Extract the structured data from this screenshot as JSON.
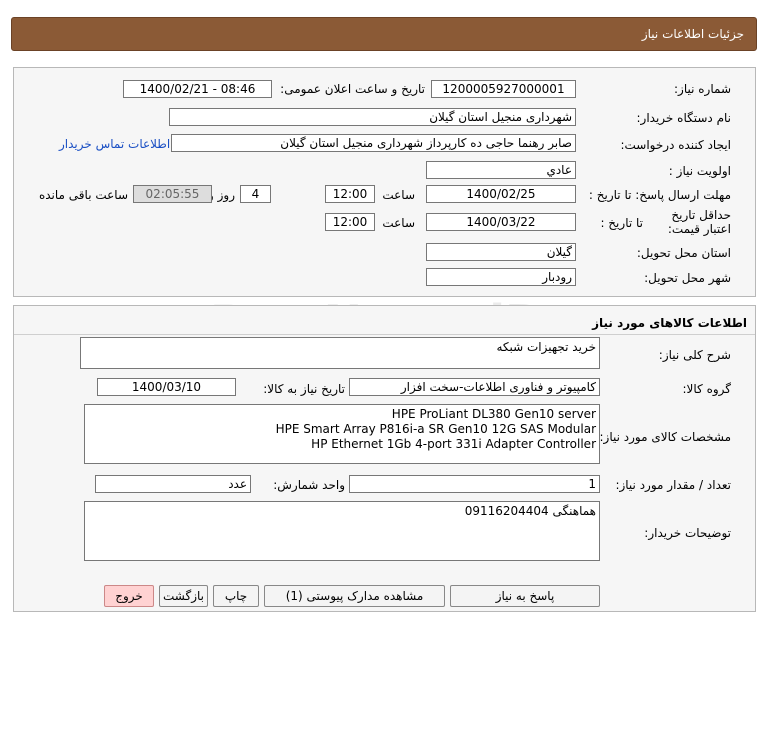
{
  "header": {
    "title": "جزئیات اطلاعات نیاز"
  },
  "need": {
    "number_label": "شماره نیاز:",
    "number": "1200005927000001",
    "announce_label": "تاریخ و ساعت اعلان عمومی:",
    "announce": "1400/02/21 - 08:46",
    "buyer_label": "نام دستگاه خریدار:",
    "buyer": "شهرداری منجیل استان گیلان",
    "requester_label": "ایجاد کننده درخواست:",
    "requester": "صابر رهنما حاجی ده کارپرداز    شهرداری منجیل استان گیلان",
    "contact_link": "اطلاعات تماس خریدار",
    "priority_label": "اولویت نیاز :",
    "priority": "عادي",
    "deadline_label": "مهلت ارسال پاسخ:  تا تاریخ :",
    "deadline_date": "1400/02/25",
    "time_label": "ساعت",
    "deadline_time": "12:00",
    "days_value": "4",
    "days_label": "روز و",
    "remaining_time": "02:05:55",
    "remaining_label": "ساعت باقی مانده",
    "validity_label": "حداقل تاریخ اعتبار قیمت:",
    "validity_to_label": "تا تاریخ :",
    "validity_date": "1400/03/22",
    "validity_time_label": "ساعت",
    "validity_time": "12:00",
    "province_label": "استان محل تحویل:",
    "province": "گیلان",
    "city_label": "شهر محل تحویل:",
    "city": "رودبار"
  },
  "goods": {
    "section_title": "اطلاعات کالاهای مورد نیاز",
    "desc_label": "شرح کلی نیاز:",
    "desc": "خرید تجهیزات شبکه",
    "group_label": "گروه کالا:",
    "group": "کامپیوتر و فناوری اطلاعات-سخت افزار",
    "need_date_label": "تاریخ نیاز به کالا:",
    "need_date": "1400/03/10",
    "specs_label": "مشخصات کالای مورد نیاز:",
    "specs": [
      "HPE ProLiant DL380 Gen10 server",
      "HPE Smart Array P816i-a SR Gen10 12G SAS Modular",
      "HP Ethernet 1Gb 4-port 331i Adapter Controller"
    ],
    "qty_label": "تعداد / مقدار مورد نیاز:",
    "qty": "1",
    "unit_label": "واحد شمارش:",
    "unit": "عدد",
    "notes_label": "توضیحات خریدار:",
    "notes": "هماهنگی 09116204404"
  },
  "buttons": {
    "reply": "پاسخ به نیاز",
    "attachments": "مشاهده مدارک پیوستی (1)",
    "print": "چاپ",
    "back": "بازگشت",
    "exit": "خروج"
  },
  "colors": {
    "header_bg": "#8b5a36",
    "link": "#1a4fc4",
    "exit_bg": "#ffd2d2"
  }
}
